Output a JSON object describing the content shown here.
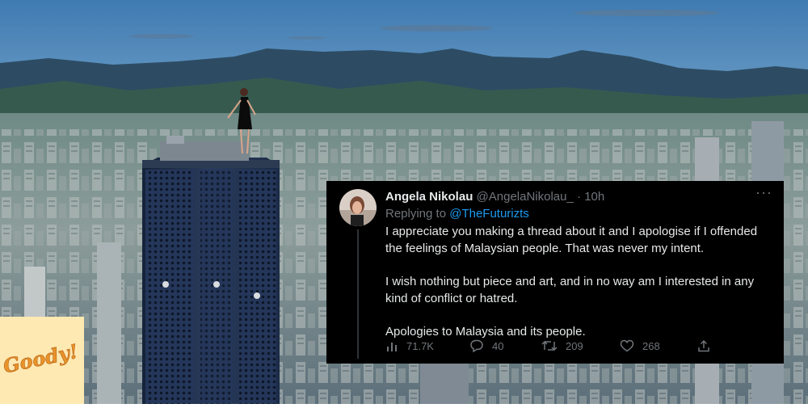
{
  "tweet": {
    "display_name": "Angela Nikolau",
    "handle": "@AngelaNikolau_",
    "separator": "·",
    "time_ago": "10h",
    "more_label": "···",
    "replying_prefix": "Replying to ",
    "replying_to": "@TheFuturizts",
    "paragraphs": [
      "I appreciate you making a thread about it and I apologise if I offended the feelings of Malaysian people. That was never my intent.",
      "I wish nothing but piece and art, and in no way am I interested in any kind of conflict or hatred.",
      "Apologies to Malaysia and its people."
    ],
    "stats": {
      "views": "71.7K",
      "replies": "40",
      "retweets": "209",
      "likes": "268"
    },
    "accent_color": "#1d9bf0",
    "muted_color": "#71767b"
  },
  "logo": {
    "text": "Goody!",
    "color": "#e8932a",
    "background": "#ffe9b2"
  },
  "icons": [
    "views-icon",
    "reply-icon",
    "retweet-icon",
    "like-icon",
    "share-icon",
    "more-icon"
  ]
}
